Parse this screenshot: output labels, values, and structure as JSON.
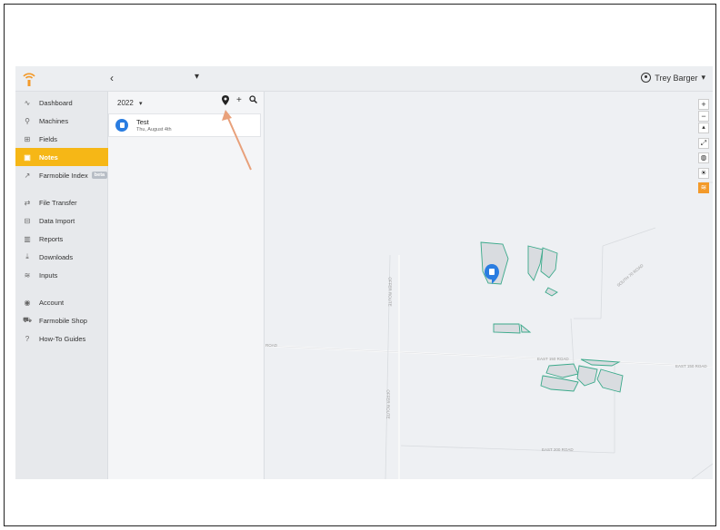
{
  "topbar": {
    "back_label": "‹",
    "scope_caret": "▾",
    "user_name": "Trey Barger",
    "user_caret": "▾"
  },
  "sidebar": {
    "items": [
      {
        "label": "Dashboard",
        "icon": "pulse-icon",
        "glyph": "∿"
      },
      {
        "label": "Machines",
        "icon": "machine-icon",
        "glyph": "⚲"
      },
      {
        "label": "Fields",
        "icon": "fields-icon",
        "glyph": "⊞"
      },
      {
        "label": "Notes",
        "icon": "notes-icon",
        "glyph": "▣",
        "active": true
      },
      {
        "label": "Farmobile Index",
        "icon": "trend-icon",
        "glyph": "↗",
        "badge": "beta"
      },
      {
        "label": "File Transfer",
        "icon": "transfer-icon",
        "glyph": "⇄"
      },
      {
        "label": "Data Import",
        "icon": "import-icon",
        "glyph": "⊟"
      },
      {
        "label": "Reports",
        "icon": "reports-icon",
        "glyph": "▥"
      },
      {
        "label": "Downloads",
        "icon": "download-icon",
        "glyph": "⤓"
      },
      {
        "label": "Inputs",
        "icon": "inputs-icon",
        "glyph": "≋"
      },
      {
        "label": "Account",
        "icon": "account-icon",
        "glyph": "◉"
      },
      {
        "label": "Farmobile Shop",
        "icon": "cart-icon",
        "glyph": "⛟"
      },
      {
        "label": "How-To Guides",
        "icon": "help-icon",
        "glyph": "?"
      }
    ]
  },
  "notes_panel": {
    "year": "2022",
    "year_caret": "▾",
    "tools": {
      "pin": "⬤",
      "add": "+",
      "search": "⚲"
    },
    "notes": [
      {
        "title": "Test",
        "date": "Thu, August 4th"
      }
    ]
  },
  "map": {
    "road_labels": [
      "ROAD",
      "EAST 150 ROAD",
      "EAST 150 ROAD",
      "EAST 200 ROAD",
      "SOUTH 70 ROAD",
      "OFFER ROUTE",
      "OFFER ROUTE"
    ],
    "controls": {
      "zoom_in": "+",
      "zoom_out": "−",
      "compass": "▴",
      "fullscreen": "⤢",
      "globe": "◍",
      "weather": "☀",
      "layers": "≋"
    },
    "field_color": "#3aa98a",
    "field_fill": "#d9dce0"
  },
  "colors": {
    "accent": "#f6b716",
    "note_blue": "#2a7de1",
    "layers_orange": "#f39a2a"
  }
}
